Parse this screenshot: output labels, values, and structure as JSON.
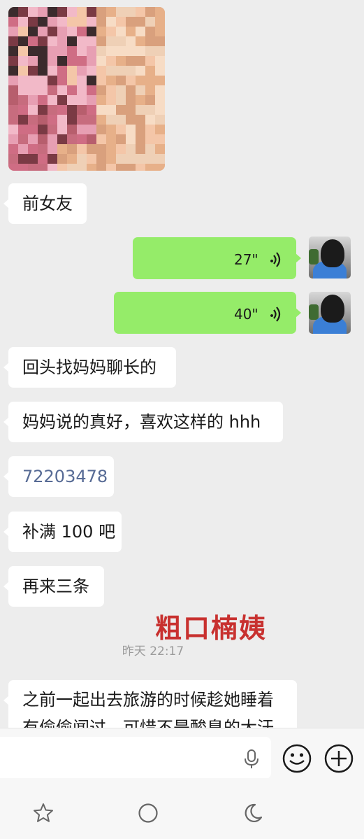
{
  "chat": {
    "image_message": {
      "description_icon": "image-thumbnail-icon",
      "pixel_colors": [
        "#f2b9c8",
        "#e79fb3",
        "#cf6d84",
        "#3b2b2d",
        "#7a3a44",
        "#f4c6a8",
        "#e7b089",
        "#d9a07d",
        "#c76c7e",
        "#efd0b6",
        "#b75e6d",
        "#f7dcc5"
      ]
    },
    "messages": [
      {
        "side": "left",
        "text": "前女友"
      },
      {
        "side": "right",
        "type": "voice",
        "duration": "27\""
      },
      {
        "side": "right",
        "type": "voice",
        "duration": "40\""
      },
      {
        "side": "left",
        "text": "回头找妈妈聊长的"
      },
      {
        "side": "left",
        "text": "妈妈说的真好，喜欢这样的 hhh"
      },
      {
        "side": "left",
        "text": "72203478"
      },
      {
        "side": "left",
        "text": "补满 100 吧"
      },
      {
        "side": "left",
        "text": "再来三条"
      },
      {
        "side": "left",
        "text": "之前一起出去旅游的时候趁她睡着有偷偷闻过，可惜不是酸臭的大汗"
      }
    ],
    "overlay_text": "粗口楠姨",
    "timestamp": "昨天 22:17"
  },
  "input_bar": {
    "placeholder": "",
    "icons": [
      "microphone-icon",
      "emoji-icon",
      "plus-icon"
    ]
  },
  "nav_bar": {
    "icons": [
      "star-icon",
      "home-circle-icon",
      "moon-icon"
    ]
  },
  "colors": {
    "background": "#ededed",
    "sent_bubble": "#95ec69",
    "received_bubble": "#ffffff",
    "link_number": "#576b95",
    "overlay_red": "#c8312f",
    "timestamp": "#9b9b9b"
  }
}
